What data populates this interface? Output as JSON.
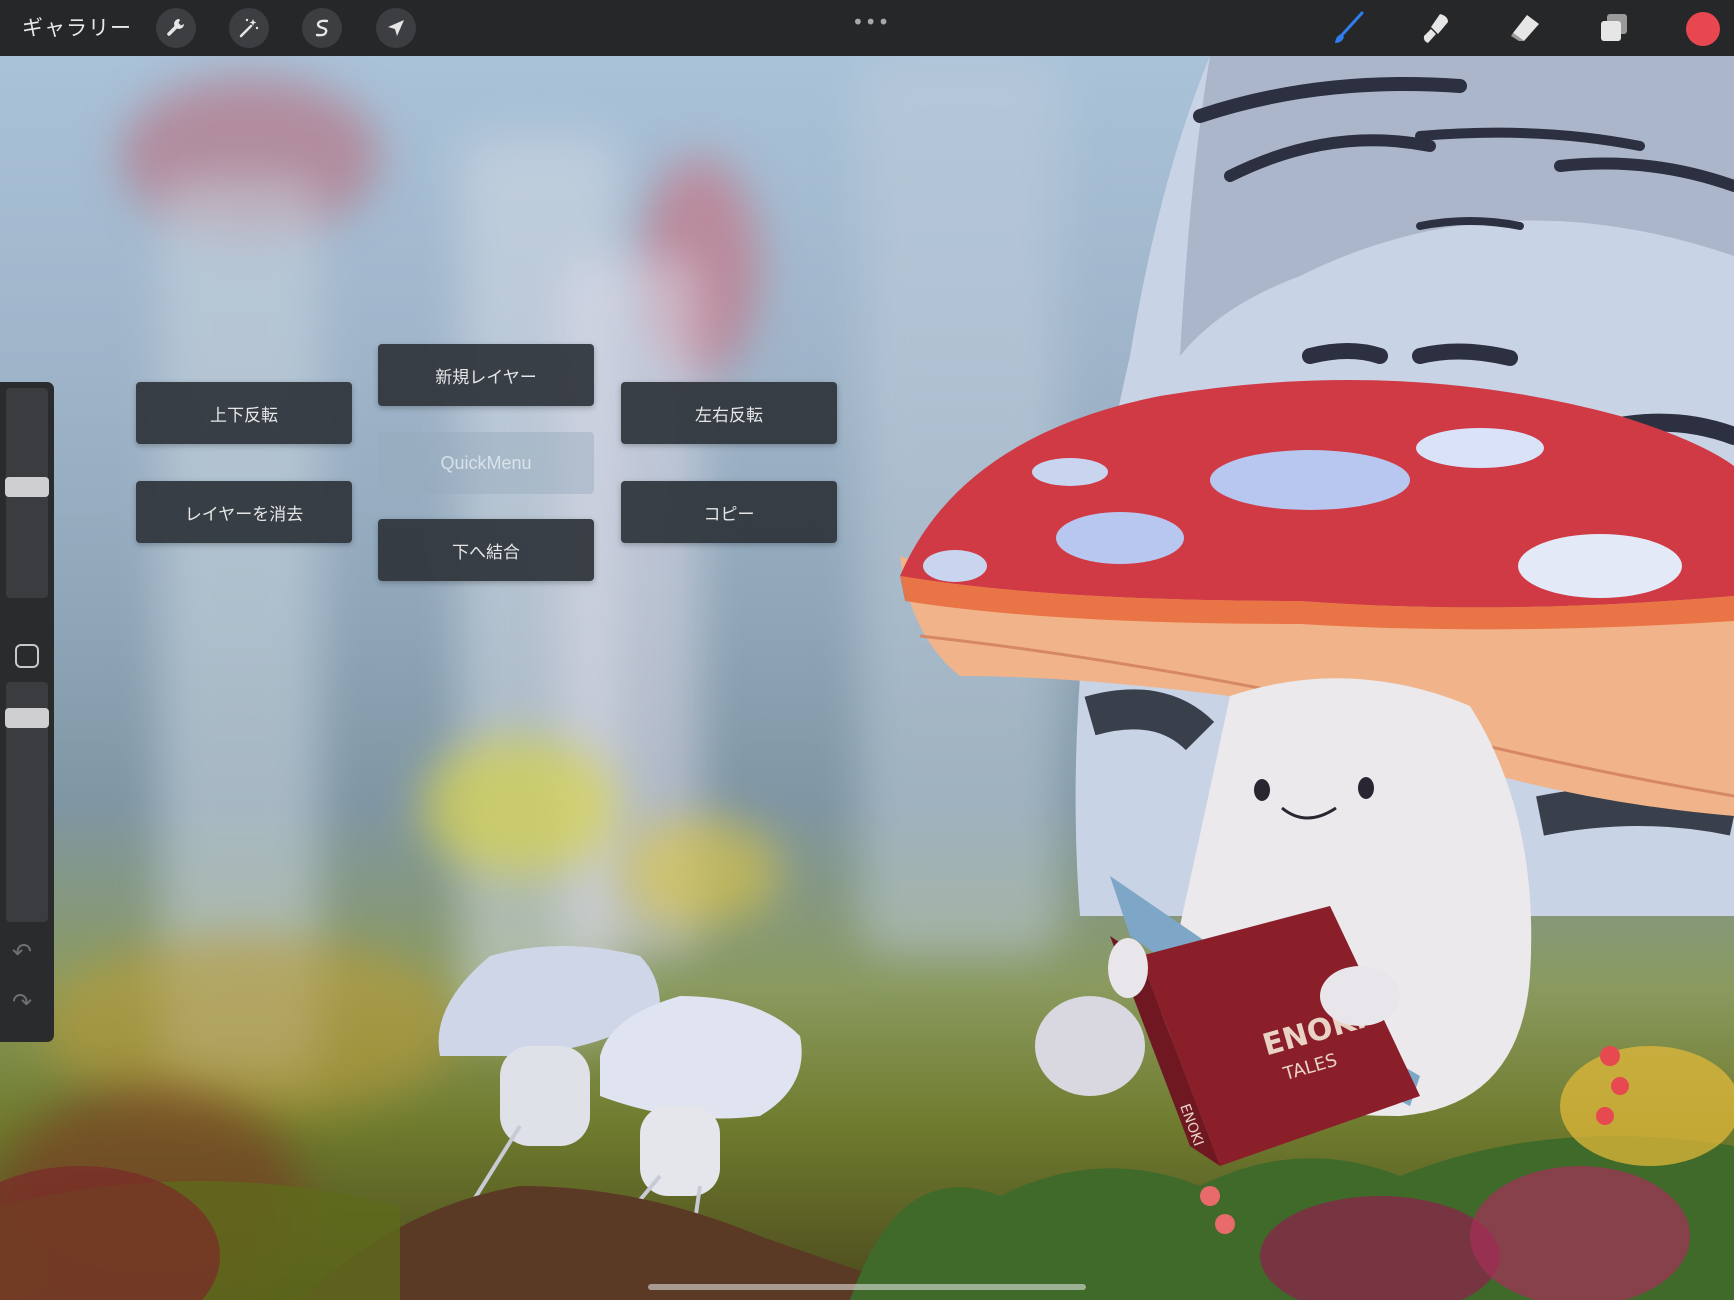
{
  "topbar": {
    "gallery_label": "ギャラリー",
    "left_tools": [
      "wrench-icon",
      "magic-wand-icon",
      "selection-icon",
      "transform-arrow-icon"
    ],
    "right_tools": [
      "brush-icon",
      "smudge-icon",
      "eraser-icon",
      "layers-icon"
    ],
    "active_color": "#e8474f",
    "brush_accent": "#2f7ef0"
  },
  "quickmenu": {
    "title": "QuickMenu",
    "new_layer": "新規レイヤー",
    "flip_vertical": "上下反転",
    "flip_horizontal": "左右反転",
    "clear_layer": "レイヤーを消去",
    "copy": "コピー",
    "merge_down": "下へ結合"
  },
  "artwork": {
    "book_title": "ENOKI",
    "book_subtitle": "TALES",
    "book_spine": "ENOKI"
  },
  "sidebar": {
    "brush_size_level": 0.55,
    "opacity_level": 0.95
  }
}
